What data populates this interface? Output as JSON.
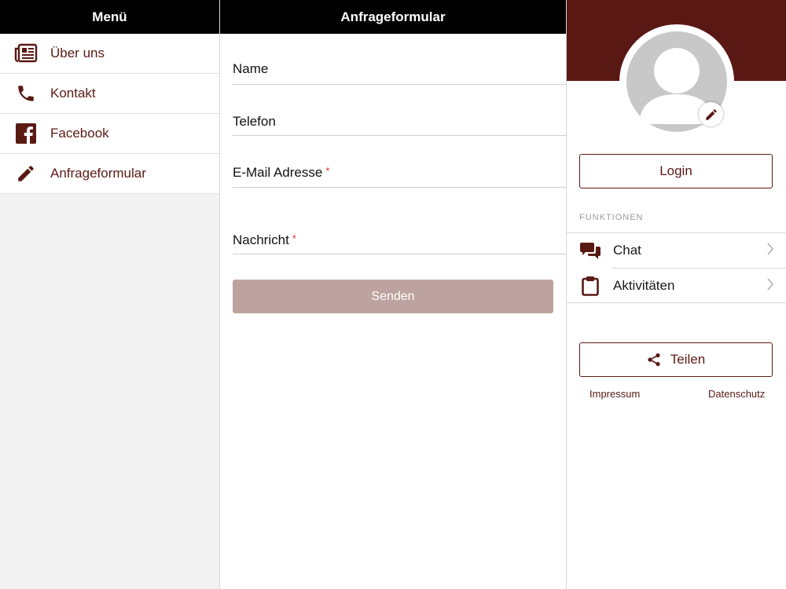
{
  "left_panel": {
    "title": "Menü",
    "items": [
      {
        "label": "Über uns",
        "icon": "newspaper-icon"
      },
      {
        "label": "Kontakt",
        "icon": "phone-icon"
      },
      {
        "label": "Facebook",
        "icon": "facebook-icon"
      },
      {
        "label": "Anfrageformular",
        "icon": "pencil-icon"
      }
    ]
  },
  "form": {
    "title": "Anfrageformular",
    "fields": {
      "name": {
        "label": "Name"
      },
      "phone": {
        "label": "Telefon"
      },
      "email": {
        "label": "E-Mail Adresse",
        "required": "*"
      },
      "message": {
        "label": "Nachricht",
        "required": "*"
      }
    },
    "submit_label": "Senden"
  },
  "profile": {
    "login_label": "Login",
    "section_label": "FUNKTIONEN",
    "functions": [
      {
        "label": "Chat",
        "icon": "chat-icon"
      },
      {
        "label": "Aktivitäten",
        "icon": "clipboard-icon"
      }
    ],
    "share_label": "Teilen",
    "links": {
      "imprint": "Impressum",
      "privacy": "Datenschutz"
    }
  },
  "colors": {
    "accent": "#5a1a14",
    "banner": "#5a1815",
    "header_bg": "#000000",
    "disabled_button": "#bda39f",
    "required": "#dd3333"
  }
}
